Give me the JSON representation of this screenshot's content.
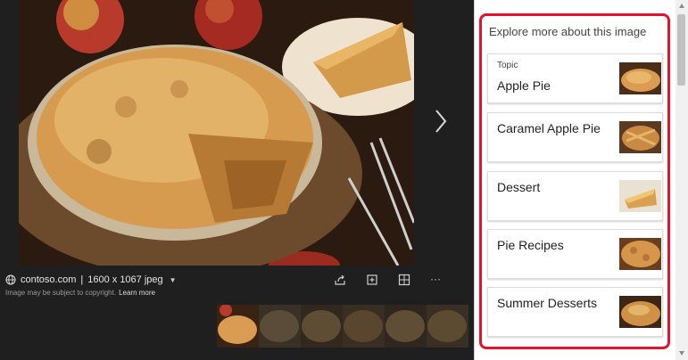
{
  "viewer": {
    "source_domain": "contoso.com",
    "separator": "|",
    "image_meta": "1600 x 1067 jpeg",
    "copyright_text": "Image may be subject to copyright.",
    "learn_more": "Learn more",
    "more_label": "···",
    "filmstrip_count": 6
  },
  "panel": {
    "title": "Explore more about this image",
    "cards": [
      {
        "kicker": "Topic",
        "label": "Apple Pie"
      },
      {
        "kicker": "",
        "label": "Caramel Apple Pie"
      },
      {
        "kicker": "",
        "label": "Dessert"
      },
      {
        "kicker": "",
        "label": "Pie Recipes"
      },
      {
        "kicker": "",
        "label": "Summer Desserts"
      }
    ]
  },
  "colors": {
    "highlight": "#e8112d",
    "viewer_bg": "#1f1f1f",
    "panel_bg": "#ffffff"
  }
}
